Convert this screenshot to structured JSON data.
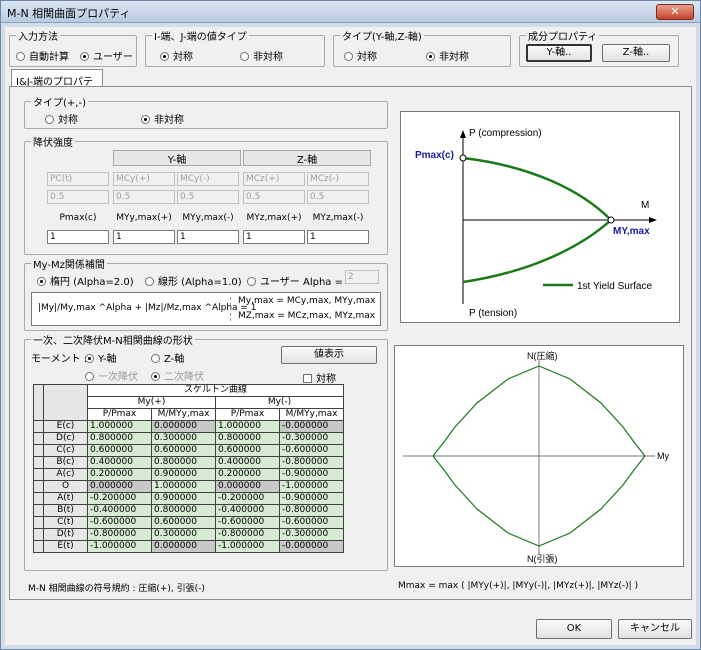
{
  "window": {
    "title": "M-N 相関曲面プロパティ",
    "close": "✕"
  },
  "input_method": {
    "label": "入力方法",
    "opt1": "自動計算",
    "opt2": "ユーザー"
  },
  "ij_type": {
    "label": "I-端、J-端の値タイプ",
    "opt1": "対称",
    "opt2": "非対称"
  },
  "axis_type": {
    "label": "タイプ(Y-軸,Z-軸)",
    "opt1": "対称",
    "opt2": "非対称"
  },
  "component": {
    "label": "成分プロパティ",
    "y_btn": "Y-軸..",
    "z_btn": "Z-軸.."
  },
  "tab": {
    "label": "I&J-端のプロパティ"
  },
  "type_pm": {
    "label": "タイプ(+,-)",
    "opt1": "対称",
    "opt2": "非対称"
  },
  "yield": {
    "label": "降伏強度",
    "y_axis": "Y-軸",
    "z_axis": "Z-軸",
    "row1": [
      "PC(t)",
      "MCy(+)",
      "MCy(-)",
      "MCz(+)",
      "MCz(-)"
    ],
    "row2": [
      "0.5",
      "0.5",
      "0.5",
      "0.5",
      "0.5"
    ],
    "row3": [
      "Pmax(c)",
      "MYy,max(+)",
      "MYy,max(-)",
      "MYz,max(+)",
      "MYz,max(-)"
    ],
    "row4": [
      "1",
      "1",
      "1",
      "1",
      "1"
    ]
  },
  "interp": {
    "label": "My-Mz関係補間",
    "opt1": "楕円 (Alpha=2.0)",
    "opt2": "線形 (Alpha=1.0)",
    "opt3": "ユーザー Alpha =",
    "alpha": "2",
    "formula_left": "|My|/My,max ^Alpha + |Mz|/Mz,max ^Alpha = 1",
    "formula_r1": "My,max = MCy,max, MYy,max",
    "formula_r2": "MZ,max = MCz,max, MYz,max"
  },
  "top_plot": {
    "p_comp": "P (compression)",
    "p_tens": "P (tension)",
    "pmax": "Pmax(c)",
    "m": "M",
    "my_max": "MY,max",
    "legend": "1st Yield Surface"
  },
  "curve": {
    "label": "一次、二次降伏M-N相関曲線の形状",
    "moment": "モーメント :",
    "y_axis": "Y-軸",
    "z_axis": "Z-軸",
    "first": "一次降伏",
    "second": "二次降伏",
    "show_btn": "値表示",
    "symmetric": "対称"
  },
  "table": {
    "skeleton": "スケルトン曲線",
    "my_pos": "My(+)",
    "my_neg": "My(-)",
    "cols": [
      "P/Pmax",
      "M/MYy,max",
      "P/Pmax",
      "M/MYy,max"
    ],
    "rows": [
      {
        "label": "E(c)",
        "v": [
          "1.000000",
          "0.000000",
          "1.000000",
          "-0.000000"
        ]
      },
      {
        "label": "D(c)",
        "v": [
          "0.800000",
          "0.300000",
          "0.800000",
          "-0.300000"
        ]
      },
      {
        "label": "C(c)",
        "v": [
          "0.600000",
          "0.600000",
          "0.600000",
          "-0.600000"
        ]
      },
      {
        "label": "B(c)",
        "v": [
          "0.400000",
          "0.800000",
          "0.400000",
          "-0.800000"
        ]
      },
      {
        "label": "A(c)",
        "v": [
          "0.200000",
          "0.900000",
          "0.200000",
          "-0.900000"
        ]
      },
      {
        "label": "O",
        "v": [
          "0.000000",
          "1.000000",
          "0.000000",
          "-1.000000"
        ]
      },
      {
        "label": "A(t)",
        "v": [
          "-0.200000",
          "0.900000",
          "-0.200000",
          "-0.900000"
        ]
      },
      {
        "label": "B(t)",
        "v": [
          "-0.400000",
          "0.800000",
          "-0.400000",
          "-0.800000"
        ]
      },
      {
        "label": "C(t)",
        "v": [
          "-0.600000",
          "0.600000",
          "-0.600000",
          "-0.600000"
        ]
      },
      {
        "label": "D(t)",
        "v": [
          "-0.800000",
          "0.300000",
          "-0.800000",
          "-0.300000"
        ]
      },
      {
        "label": "E(t)",
        "v": [
          "-1.000000",
          "0.000000",
          "-1.000000",
          "-0.000000"
        ]
      }
    ]
  },
  "bottom_plot": {
    "n_comp": "N(圧縮)",
    "n_tens": "N(引張)",
    "my": "My"
  },
  "status": {
    "left": "M-N 相関曲線の符号規約 : 圧縮(+), 引張(-)",
    "right": "Mmax = max ( |MYy(+)|, |MYy(-)|, |MYz(+)|, |MYz(-)| )"
  },
  "footer": {
    "ok": "OK",
    "cancel": "キャンセル"
  },
  "colors": {
    "curve": "#1a7a1a",
    "cell_green": "#d6ecd2",
    "cell_gray": "#c8c8c8"
  }
}
